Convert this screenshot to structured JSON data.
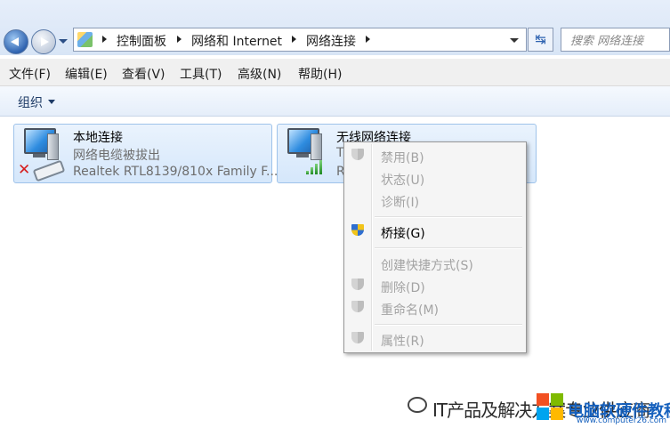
{
  "address_bar": {
    "breadcrumbs": [
      "控制面板",
      "网络和 Internet",
      "网络连接"
    ],
    "search_placeholder": "搜索 网络连接",
    "refresh_symbol": "↹"
  },
  "menu": {
    "items": [
      "文件(F)",
      "编辑(E)",
      "查看(V)",
      "工具(T)",
      "高级(N)",
      "帮助(H)"
    ]
  },
  "command_bar": {
    "organize_label": "组织"
  },
  "connections": [
    {
      "title": "本地连接",
      "line1": "网络电缆被拔出",
      "line2": "Realtek RTL8139/810x Family F...",
      "status_icon": "red-x-icon"
    },
    {
      "title": "无线网络连接",
      "line1": "T",
      "line2": "R",
      "status_icon": "signal-bars-icon"
    }
  ],
  "context_menu": {
    "items": [
      {
        "label": "禁用(B)",
        "enabled": false,
        "shield": true
      },
      {
        "label": "状态(U)",
        "enabled": false,
        "shield": false
      },
      {
        "label": "诊断(I)",
        "enabled": false,
        "shield": false
      },
      {
        "label": "桥接(G)",
        "enabled": true,
        "shield": true
      },
      {
        "label": "创建快捷方式(S)",
        "enabled": false,
        "shield": false
      },
      {
        "label": "删除(D)",
        "enabled": false,
        "shield": true
      },
      {
        "label": "重命名(M)",
        "enabled": false,
        "shield": true
      },
      {
        "label": "属性(R)",
        "enabled": false,
        "shield": true
      }
    ]
  },
  "watermark": {
    "text": "IT产品及解决方案专业供应商",
    "site_name": "电脑软硬件教程网",
    "site_url": "www.computer26.com"
  },
  "colors": {
    "accent": "#2f63b0",
    "tile_bg": "#d5e7fb",
    "disabled_text": "#a3a3a3"
  }
}
